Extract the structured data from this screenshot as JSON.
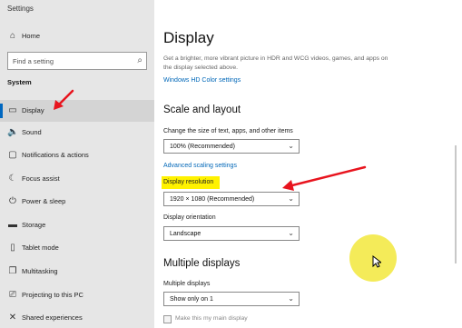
{
  "window": {
    "title": "Settings",
    "controls": {
      "minimize": "—",
      "maximize": "☐",
      "close": "✕"
    }
  },
  "sidebar": {
    "home": {
      "label": "Home",
      "icon": "home-icon"
    },
    "search_placeholder": "Find a setting",
    "section": "System",
    "items": [
      {
        "label": "Display",
        "icon": "display-icon",
        "active": true
      },
      {
        "label": "Sound",
        "icon": "sound-icon"
      },
      {
        "label": "Notifications & actions",
        "icon": "notifications-icon"
      },
      {
        "label": "Focus assist",
        "icon": "focus-assist-icon"
      },
      {
        "label": "Power & sleep",
        "icon": "power-icon"
      },
      {
        "label": "Storage",
        "icon": "storage-icon"
      },
      {
        "label": "Tablet mode",
        "icon": "tablet-mode-icon"
      },
      {
        "label": "Multitasking",
        "icon": "multitasking-icon"
      },
      {
        "label": "Projecting to this PC",
        "icon": "projecting-icon"
      },
      {
        "label": "Shared experiences",
        "icon": "shared-experiences-icon"
      }
    ]
  },
  "main": {
    "title": "Display",
    "description": "Get a brighter, more vibrant picture in HDR and WCG videos, games, and apps on the display selected above.",
    "hdr_link": "Windows HD Color settings",
    "scale_heading": "Scale and layout",
    "scale_label": "Change the size of text, apps, and other items",
    "scale_value": "100% (Recommended)",
    "advanced_link": "Advanced scaling settings",
    "resolution_label": "Display resolution",
    "resolution_value": "1920 × 1080 (Recommended)",
    "orientation_label": "Display orientation",
    "orientation_value": "Landscape",
    "multi_heading": "Multiple displays",
    "multi_label": "Multiple displays",
    "multi_value": "Show only on 1",
    "main_display_label": "Make this my main display"
  },
  "colors": {
    "accent": "#0067c0",
    "link": "#0067b8",
    "annotation_arrow": "#e8141e",
    "highlight": "#fff200"
  }
}
